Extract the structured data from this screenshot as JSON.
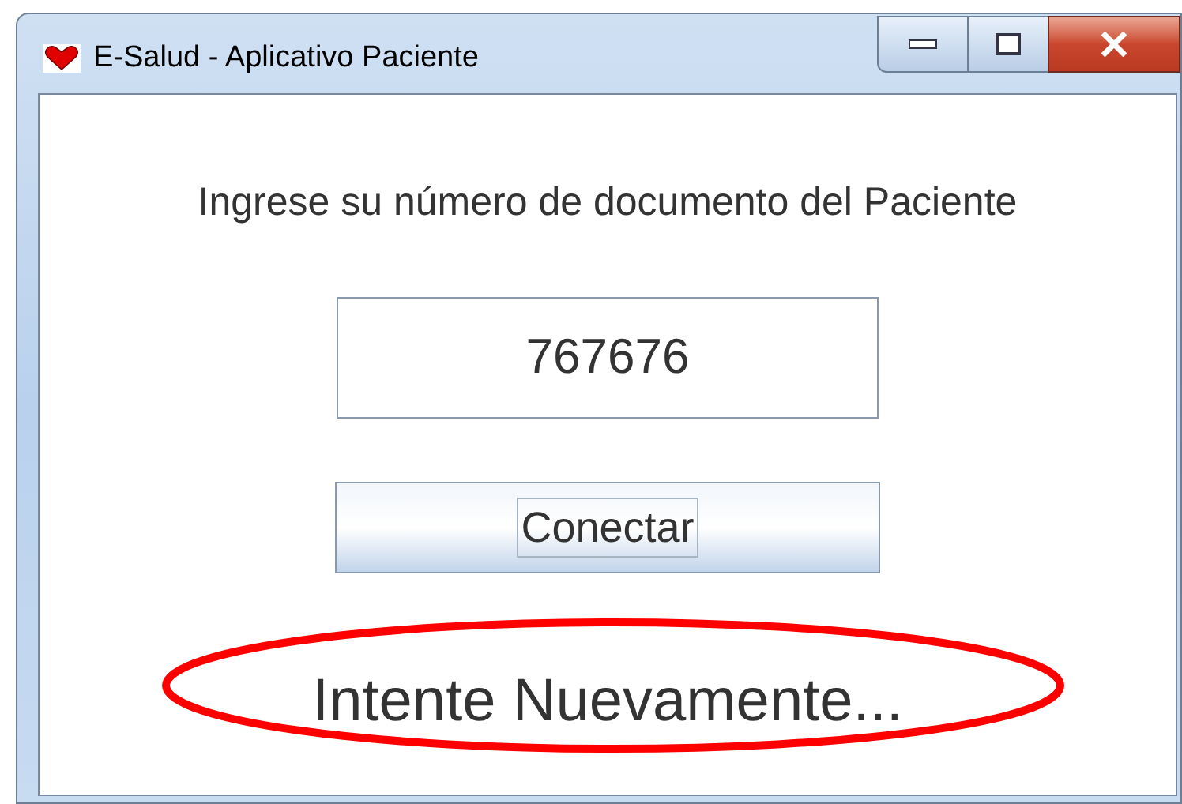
{
  "window": {
    "title": "E-Salud - Aplicativo Paciente"
  },
  "form": {
    "prompt": "Ingrese su número de documento del Paciente",
    "document_field": {
      "value": "767676"
    },
    "connect_button": {
      "label": "Conectar",
      "focused": true
    }
  },
  "status": {
    "message": "Intente Nuevamente...",
    "circled": true
  }
}
